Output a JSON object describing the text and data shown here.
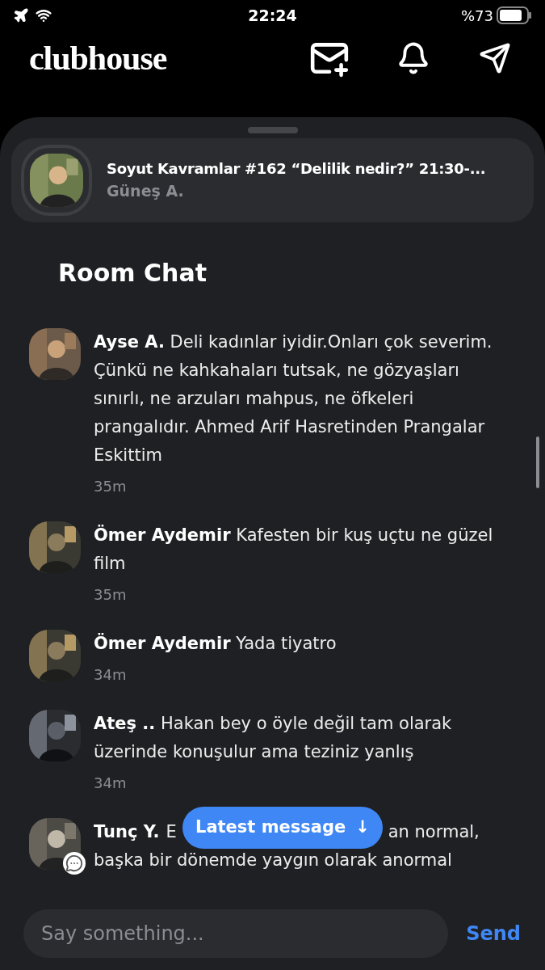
{
  "status_bar": {
    "time": "22:24",
    "battery": "%73"
  },
  "header": {
    "logo": "clubhouse"
  },
  "room_card": {
    "title": "Soyut Kavramlar #162 “Delilik nedir?” 21:30-...",
    "host": "Güneş A."
  },
  "chat": {
    "title": "Room Chat",
    "messages": [
      {
        "name": "Ayse A.",
        "text": "Deli kadınlar iyidir.Onları çok severim. Çünkü ne kahkahaları tutsak, ne gözyaşları sınırlı, ne arzuları mahpus, ne öfkeleri prangalıdır. Ahmed Arif Hasretinden Prangalar Eskittim",
        "time": "35m",
        "chat_badge": false
      },
      {
        "name": "Ömer Aydemir",
        "text": "Kafesten bir kuş uçtu ne güzel film",
        "time": "35m",
        "chat_badge": false
      },
      {
        "name": "Ömer Aydemir",
        "text": "Yada tiyatro",
        "time": "34m",
        "chat_badge": false
      },
      {
        "name": "Ateş ..",
        "text": "Hakan bey o öyle değil tam olarak üzerinde konuşulur ama teziniz yanlış",
        "time": "34m",
        "chat_badge": false
      },
      {
        "name": "Tunç Y.",
        "text_start": "E",
        "text_end": "an normal,",
        "line_2": "başka bir dönemde yaygın olarak anormal",
        "chat_badge": true
      }
    ]
  },
  "latest_button": {
    "label": "Latest message",
    "arrow": "↓"
  },
  "composer": {
    "placeholder": "Say something...",
    "send": "Send"
  }
}
